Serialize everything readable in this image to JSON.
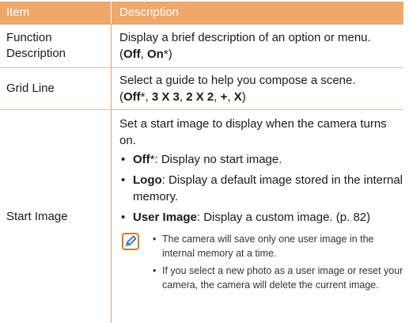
{
  "header": {
    "item": "Item",
    "description": "Description"
  },
  "rows": [
    {
      "item_line1": "Function",
      "item_line2": "Description",
      "desc": "Display a brief description of an option or menu.",
      "opts": {
        "open": "(",
        "o1": "Off",
        "sep1": ", ",
        "o2": "On",
        "o2_mark": "*",
        "close": ")"
      }
    },
    {
      "item": "Grid Line",
      "desc": "Select a guide to help you compose a scene.",
      "opts": {
        "open": "(",
        "o1": "Off",
        "o1_mark": "*",
        "sep1": ", ",
        "o2": "3 X 3",
        "sep2": ", ",
        "o3": "2 X 2",
        "sep3": ", ",
        "o4": "+",
        "sep4": ", ",
        "o5": "X",
        "close": ")"
      }
    },
    {
      "item": "Start Image",
      "desc": "Set a start image to display when the camera turns on.",
      "bullets": [
        {
          "bullet": "•",
          "term": "Off",
          "mark": "*",
          "text": ": Display no start image."
        },
        {
          "bullet": "•",
          "term": "Logo",
          "text": ": Display a default image stored in the internal memory."
        },
        {
          "bullet": "•",
          "term": "User Image",
          "text": ": Display a custom image. (p. 82)"
        }
      ],
      "note": {
        "icon": "note-pencil-icon",
        "items": [
          {
            "bullet": "•",
            "text": "The camera will save only one user image in the internal memory at a time."
          },
          {
            "bullet": "•",
            "text": "If you select a new photo as a user image or reset your camera, the camera will delete the current image."
          }
        ]
      }
    }
  ],
  "colors": {
    "header_bg": "#f0a86a",
    "header_text": "#ffffff",
    "divider": "#d8a27a",
    "icon_accent": "#e07a2a"
  }
}
